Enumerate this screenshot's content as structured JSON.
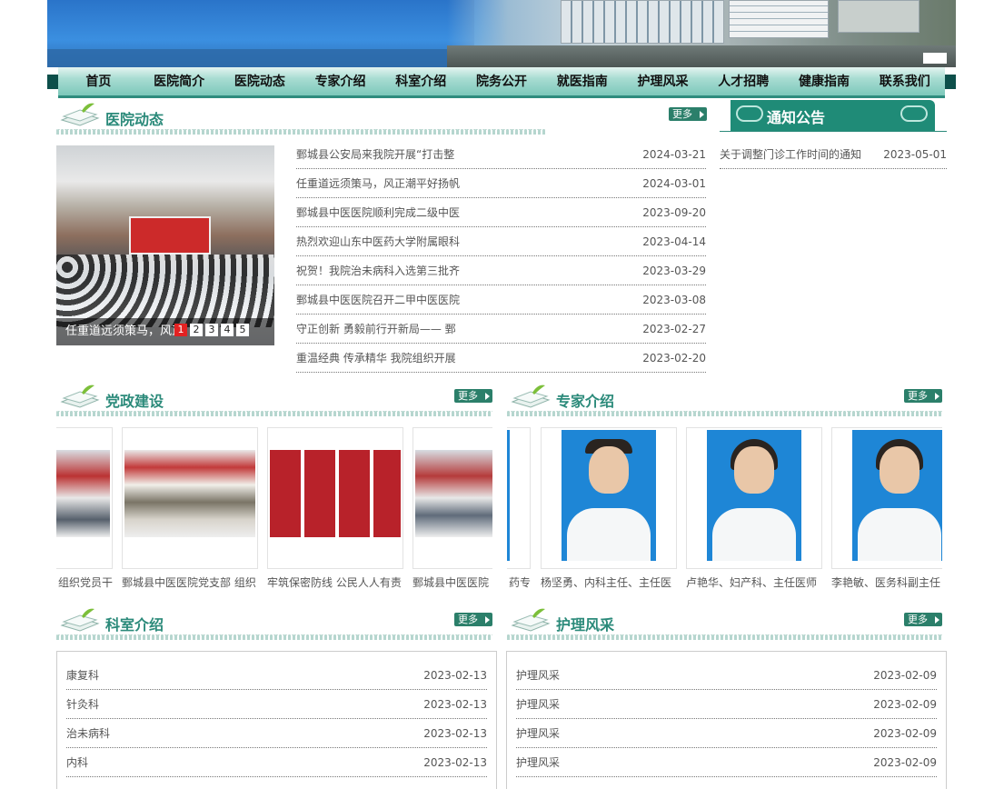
{
  "nav": [
    "首页",
    "医院简介",
    "医院动态",
    "专家介绍",
    "科室介绍",
    "院务公开",
    "就医指南",
    "护理风采",
    "人才招聘",
    "健康指南",
    "联系我们"
  ],
  "more_label": "更多",
  "news": {
    "title": "医院动态",
    "slider": {
      "caption": "任重道远须策马，风正",
      "pages": [
        "1",
        "2",
        "3",
        "4",
        "5"
      ],
      "active_page": "1"
    },
    "items": [
      {
        "title": "鄄城县公安局来我院开展“打击整",
        "date": "2024-03-21"
      },
      {
        "title": "任重道远须策马，风正潮平好扬帆",
        "date": "2024-03-01"
      },
      {
        "title": "鄄城县中医医院顺利完成二级中医",
        "date": "2023-09-20"
      },
      {
        "title": "热烈欢迎山东中医药大学附属眼科",
        "date": "2023-04-14"
      },
      {
        "title": "祝贺！我院治未病科入选第三批齐",
        "date": "2023-03-29"
      },
      {
        "title": "鄄城县中医医院召开二甲中医医院",
        "date": "2023-03-08"
      },
      {
        "title": "守正创新 勇毅前行开新局—— 鄄",
        "date": "2023-02-27"
      },
      {
        "title": "重温经典 传承精华 我院组织开展",
        "date": "2023-02-20"
      }
    ]
  },
  "notice": {
    "title": "通知公告",
    "items": [
      {
        "title": "关于调整门诊工作时间的通知",
        "date": "2023-05-01"
      }
    ]
  },
  "party": {
    "title": "党政建设",
    "items": [
      {
        "caption": "组织党员干"
      },
      {
        "caption": "鄄城县中医医院党支部 组织"
      },
      {
        "caption": "牢筑保密防线 公民人人有责"
      },
      {
        "caption": "鄄城县中医医院"
      }
    ]
  },
  "experts": {
    "title": "专家介绍",
    "items": [
      {
        "caption": "药专"
      },
      {
        "caption": "杨坚勇、内科主任、主任医"
      },
      {
        "caption": "卢艳华、妇产科、主任医师"
      },
      {
        "caption": "李艳敏、医务科副主任"
      }
    ]
  },
  "departments": {
    "title": "科室介绍",
    "items": [
      {
        "title": "康复科",
        "date": "2023-02-13"
      },
      {
        "title": "针灸科",
        "date": "2023-02-13"
      },
      {
        "title": "治未病科",
        "date": "2023-02-13"
      },
      {
        "title": "内科",
        "date": "2023-02-13"
      }
    ]
  },
  "nursing": {
    "title": "护理风采",
    "items": [
      {
        "title": "护理风采",
        "date": "2023-02-09"
      },
      {
        "title": "护理风采",
        "date": "2023-02-09"
      },
      {
        "title": "护理风采",
        "date": "2023-02-09"
      },
      {
        "title": "护理风采",
        "date": "2023-02-09"
      }
    ]
  },
  "colors": {
    "accent": "#2b8a7a",
    "notice_bg": "#1f8b77",
    "more_bg": "#2b7f6a",
    "pager_active": "#e32222"
  }
}
